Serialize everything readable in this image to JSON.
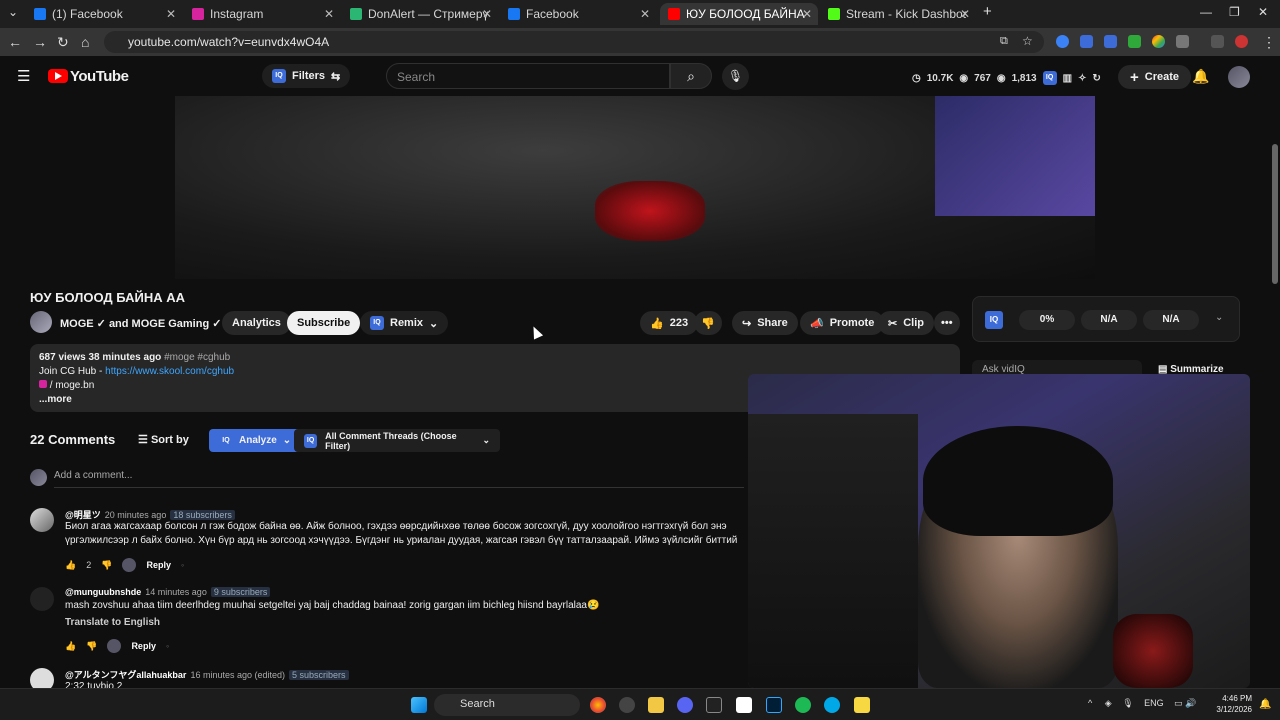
{
  "browser": {
    "tabs": [
      {
        "title": "(1) Facebook",
        "color": "#1877f2"
      },
      {
        "title": "Instagram",
        "color": "#d6249f"
      },
      {
        "title": "DonAlert — Стримерүүдэд зор",
        "color": "#2bb673"
      },
      {
        "title": "Facebook",
        "color": "#1877f2"
      },
      {
        "title": "ЮУ БОЛООД БАЙНА АА - You",
        "color": "#ff0000"
      },
      {
        "title": "Stream - Kick Dashboard",
        "color": "#53fc18"
      }
    ],
    "url": "youtube.com/watch?v=eunvdx4wO4A"
  },
  "yt": {
    "logo": "YouTube",
    "filters_label": "Filters",
    "search_placeholder": "Search",
    "stats": {
      "views": "10.7K",
      "eyes": "767",
      "subs": "1,813"
    },
    "create_label": "Create"
  },
  "video": {
    "title": "ЮУ БОЛООД БАЙНА АА",
    "channel": "MOGE ✓ and MOGE Gaming ✓",
    "analytics_label": "Analytics",
    "subscribe_label": "Subscribe",
    "remix_label": "Remix",
    "like_count": "223",
    "share_label": "Share",
    "promote_label": "Promote",
    "clip_label": "Clip",
    "more_label": "•••"
  },
  "vidiq": {
    "badge": "IQ",
    "score": "0%",
    "metric2": "N/A",
    "metric3": "N/A",
    "ask_placeholder": "Ask vidIQ",
    "summarize_label": "Summarize"
  },
  "description": {
    "meta": "687 views  38 minutes ago",
    "tags": "#moge #cghub",
    "line2_prefix": "Join CG Hub - ",
    "line2_link": "https://www.skool.com/cghub",
    "line3": "/ moge.bn",
    "more": "...more"
  },
  "comments": {
    "header": "22 Comments",
    "sort_label": "Sort by",
    "analyze_label": "Analyze",
    "filter_label": "All Comment Threads (Choose Filter)",
    "add_placeholder": "Add a comment...",
    "items": [
      {
        "author": "@明星ツ",
        "time": "20 minutes ago",
        "subs": "18 subscribers",
        "text": "Биол агаа жагсахаар болсон л гэж бодож байна өө. Айж болноо, гэхдээ өөрсдийнхөө төлөө босож зогсохгүй, дуу хоолойгоо нэгтгэхгүй бол энэ үргэлжилсээр л байх болно. Хүн бүр ард нь зогсоод хэчүүдээ. Бүгдэнг нь уриалан дуудая, жагсая гэвэл бүү татталзаарай. Иймэ зүйлсийг биттий нуун дарагдуулаарай, тэмц гэж хэлье🙏.",
        "likes": "2",
        "reply": "Reply"
      },
      {
        "author": "@munguubnshde",
        "time": "14 minutes ago",
        "subs": "9 subscribers",
        "text": "mash zovshuu ahaa tiim deerlhdeg muuhai setgeltei yaj baij chaddag bainaa! zorig gargan iim bichleg hiisnd bayrlalaa😢",
        "translate": "Translate to English",
        "reply": "Reply"
      },
      {
        "author": "@アルタンフヤグallahuakbar",
        "time": "16 minutes ago (edited)",
        "subs": "5 subscribers",
        "text": "2:32 tuybio 2"
      }
    ]
  },
  "taskbar": {
    "search_label": "Search",
    "lang": "ENG",
    "time": "4:46 PM",
    "date": "3/12/2026"
  }
}
